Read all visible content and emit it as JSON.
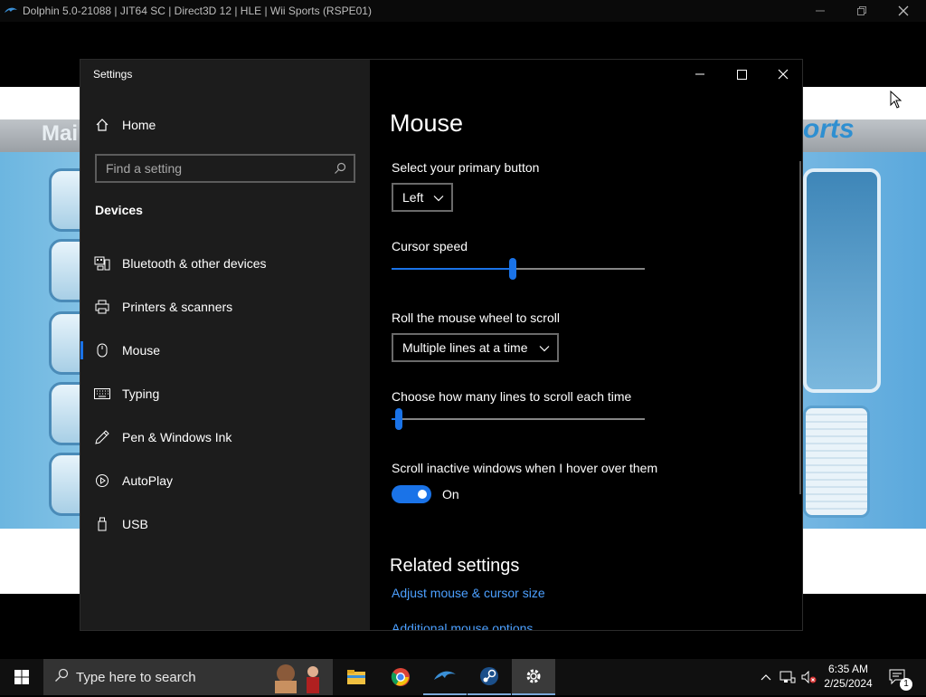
{
  "dolphin": {
    "title": "Dolphin 5.0-21088 | JIT64 SC | Direct3D 12 | HLE | Wii Sports (RSPE01)",
    "logo_icon": "dolphin-logo-icon"
  },
  "game": {
    "text_left": "Mai",
    "text_right": "orts"
  },
  "settings": {
    "window_title": "Settings",
    "home_label": "Home",
    "search_placeholder": "Find a setting",
    "section_label": "Devices",
    "nav_items": [
      {
        "label": "Bluetooth & other devices",
        "icon": "bluetooth-devices-icon"
      },
      {
        "label": "Printers & scanners",
        "icon": "printer-icon"
      },
      {
        "label": "Mouse",
        "icon": "mouse-icon",
        "selected": true
      },
      {
        "label": "Typing",
        "icon": "keyboard-icon"
      },
      {
        "label": "Pen & Windows Ink",
        "icon": "pen-icon"
      },
      {
        "label": "AutoPlay",
        "icon": "autoplay-icon"
      },
      {
        "label": "USB",
        "icon": "usb-icon"
      }
    ],
    "page_title": "Mouse",
    "primary_button": {
      "label": "Select your primary button",
      "value": "Left"
    },
    "cursor_speed": {
      "label": "Cursor speed",
      "level": 0.48
    },
    "scroll": {
      "label": "Roll the mouse wheel to scroll",
      "value": "Multiple lines at a time"
    },
    "lines_scroll": {
      "label": "Choose how many lines to scroll each time",
      "level": 0.03
    },
    "inactive_scroll": {
      "label": "Scroll inactive windows when I hover over them",
      "state": "On",
      "enabled": true
    },
    "related": {
      "heading": "Related settings",
      "links": [
        "Adjust mouse & cursor size",
        "Additional mouse options"
      ]
    },
    "accent_color": "#1a73e8",
    "link_color": "#4ca0ff"
  },
  "taskbar": {
    "search_placeholder": "Type here to search",
    "apps": [
      "file-explorer-icon",
      "chrome-icon",
      "dolphin-icon",
      "steam-icon",
      "settings-icon"
    ],
    "clock_time": "6:35 AM",
    "clock_date": "2/25/2024",
    "notification_count": "1"
  }
}
